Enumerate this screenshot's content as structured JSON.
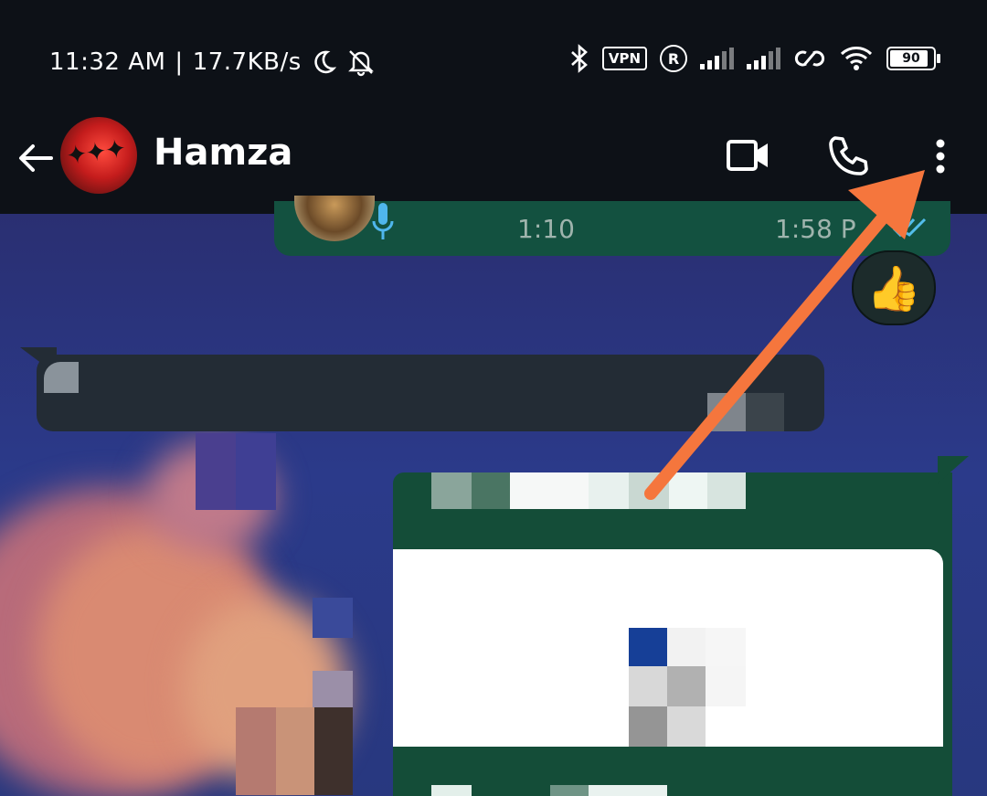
{
  "status_bar": {
    "time": "11:32 AM",
    "separator": "|",
    "network_speed": "17.7KB/s",
    "vpn_label": "VPN",
    "roaming_label": "R",
    "battery_level": "90",
    "icons": [
      "moon-icon",
      "mute-bell-icon",
      "bluetooth-icon",
      "vpn-icon",
      "roaming-icon",
      "signal-icon",
      "signal-icon",
      "hotspot-icon",
      "wifi-icon",
      "battery-icon"
    ]
  },
  "app_bar": {
    "contact_name": "Hamza",
    "icons": [
      "back-arrow-icon",
      "video-call-icon",
      "voice-call-icon",
      "more-options-icon"
    ]
  },
  "messages": {
    "voice_note": {
      "duration": "1:10",
      "timestamp": "1:58 P"
    },
    "reaction": "👍"
  },
  "colors": {
    "bar_bg": "#0d1117",
    "outgoing_bubble": "#144d38",
    "incoming_bubble": "#232c35",
    "annotation_arrow": "#f5763d"
  }
}
